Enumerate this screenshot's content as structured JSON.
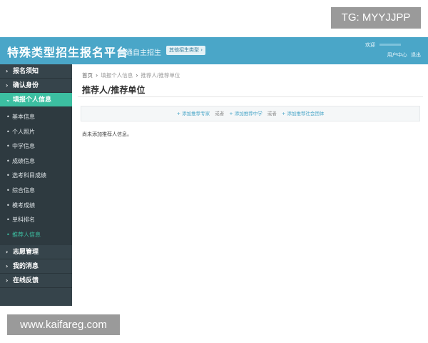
{
  "watermark_top": "TG: MYYJJPP",
  "watermark_bottom": "www.kaifareg.com",
  "header": {
    "title": "特殊类型招生报名平台",
    "mode": "普通自主招生",
    "switch_label": "其他招生类型",
    "welcome": "欢迎",
    "user_center": "用户中心",
    "logout": "退出"
  },
  "sidebar": {
    "top_sections": [
      {
        "label": "报名须知"
      },
      {
        "label": "确认身份"
      },
      {
        "label": "填报个人信息"
      }
    ],
    "sub_items": [
      {
        "label": "基本信息"
      },
      {
        "label": "个人照片"
      },
      {
        "label": "中学信息"
      },
      {
        "label": "成绩信息"
      },
      {
        "label": "选考科目成绩"
      },
      {
        "label": "综合信息"
      },
      {
        "label": "模考成绩"
      },
      {
        "label": "单科排名"
      },
      {
        "label": "推荐人信息"
      }
    ],
    "bottom_sections": [
      {
        "label": "志愿管理"
      },
      {
        "label": "我的消息"
      },
      {
        "label": "在线反馈"
      }
    ]
  },
  "breadcrumb": {
    "home": "首页",
    "level1": "填报个人信息",
    "level2": "推荐人/推荐单位"
  },
  "page_title": "推荐人/推荐单位",
  "actions": {
    "add_expert": "添加推荐专家",
    "or1": "或者",
    "add_school": "添加推荐中学",
    "or2": "或者",
    "add_org": "添加推荐社会团体"
  },
  "empty_message": "尚未添加推荐人信息。",
  "colors": {
    "header_bg": "#4aa6c8",
    "sidebar_bg": "#36444b",
    "active_bg": "#3cbfa1"
  }
}
